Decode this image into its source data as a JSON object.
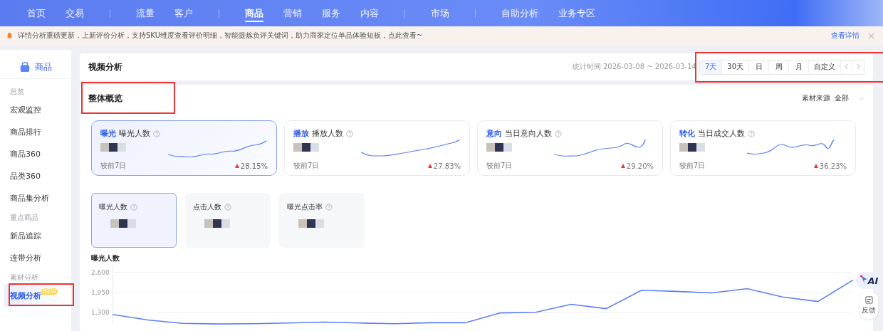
{
  "top_nav": {
    "groups": [
      {
        "items": [
          {
            "label": "首页",
            "selected": false
          },
          {
            "label": "交易",
            "selected": false
          }
        ]
      },
      {
        "items": [
          {
            "label": "流量",
            "selected": false
          },
          {
            "label": "客户",
            "selected": false
          }
        ]
      },
      {
        "items": [
          {
            "label": "商品",
            "selected": true
          },
          {
            "label": "营销",
            "selected": false
          },
          {
            "label": "服务",
            "selected": false
          },
          {
            "label": "内容",
            "selected": false
          }
        ]
      },
      {
        "items": [
          {
            "label": "市场",
            "selected": false
          }
        ]
      },
      {
        "items": [
          {
            "label": "自助分析",
            "selected": false
          },
          {
            "label": "业务专区",
            "selected": false
          }
        ]
      }
    ]
  },
  "notice": {
    "text": "详情分析重磅更新，上新评价分析，支持SKU维度查看评价明细，智能提炼负评关键词，助力商家定位单品体验短板，点此查看~",
    "link": "查看详情"
  },
  "sidebar": {
    "title": "商品",
    "items": [
      {
        "kind": "group",
        "label": "总览"
      },
      {
        "kind": "item",
        "label": "宏观监控",
        "selected": false
      },
      {
        "kind": "item",
        "label": "商品排行",
        "selected": false
      },
      {
        "kind": "item",
        "label": "商品360",
        "selected": false
      },
      {
        "kind": "item",
        "label": "品类360",
        "selected": false
      },
      {
        "kind": "item",
        "label": "商品集分析",
        "selected": false
      },
      {
        "kind": "group",
        "label": "重点商品"
      },
      {
        "kind": "item",
        "label": "新品追踪",
        "selected": false
      },
      {
        "kind": "item",
        "label": "连带分析",
        "selected": false
      },
      {
        "kind": "group",
        "label": "素材分析"
      },
      {
        "kind": "item",
        "label": "视频分析",
        "selected": true,
        "badge": "NEW"
      }
    ]
  },
  "header": {
    "title": "视频分析",
    "stat_time": "统计时间 2026-03-08 ~ 2026-03-14",
    "ranges": [
      {
        "label": "7天",
        "selected": true
      },
      {
        "label": "30天",
        "selected": false
      },
      {
        "label": "日",
        "selected": false
      },
      {
        "label": "周",
        "selected": false
      },
      {
        "label": "月",
        "selected": false
      },
      {
        "label": "自定义",
        "selected": false
      }
    ]
  },
  "overview": {
    "title": "整体概览",
    "source_label": "素材来源",
    "source_value": "全部",
    "metrics": [
      {
        "tag": "曝光",
        "name": "曝光人数",
        "compare": "较前7日",
        "change": "28.15%",
        "selected": true
      },
      {
        "tag": "播放",
        "name": "播放人数",
        "compare": "较前7日",
        "change": "27.83%",
        "selected": false
      },
      {
        "tag": "意向",
        "name": "当日意向人数",
        "compare": "较前7日",
        "change": "29.20%",
        "selected": false
      },
      {
        "tag": "转化",
        "name": "当日成交人数",
        "compare": "较前7日",
        "change": "36.23%",
        "selected": false
      }
    ],
    "sub_metrics": [
      {
        "name": "曝光人数",
        "selected": true
      },
      {
        "name": "点击人数",
        "selected": false
      },
      {
        "name": "曝光点击率",
        "selected": false
      }
    ],
    "chart": {
      "chart_data": {
        "type": "line",
        "title": "曝光人数",
        "grid": true,
        "ylim": [
          900,
          2800
        ],
        "yticks": [
          {
            "value": 1300,
            "label": "1,300"
          },
          {
            "value": 1950,
            "label": "1,950"
          },
          {
            "value": 2600,
            "label": "2,600"
          }
        ],
        "series": [
          {
            "color": "#5b7ff5",
            "values": [
              1230,
              1050,
              940,
              920,
              930,
              950,
              980,
              950,
              930,
              960,
              960,
              1280,
              1300,
              1560,
              1420,
              2020,
              1980,
              1930,
              2070,
              1800,
              1650,
              2350
            ]
          }
        ]
      }
    }
  },
  "float_tools": {
    "ai_label": "AI",
    "feedback": "反馈"
  }
}
